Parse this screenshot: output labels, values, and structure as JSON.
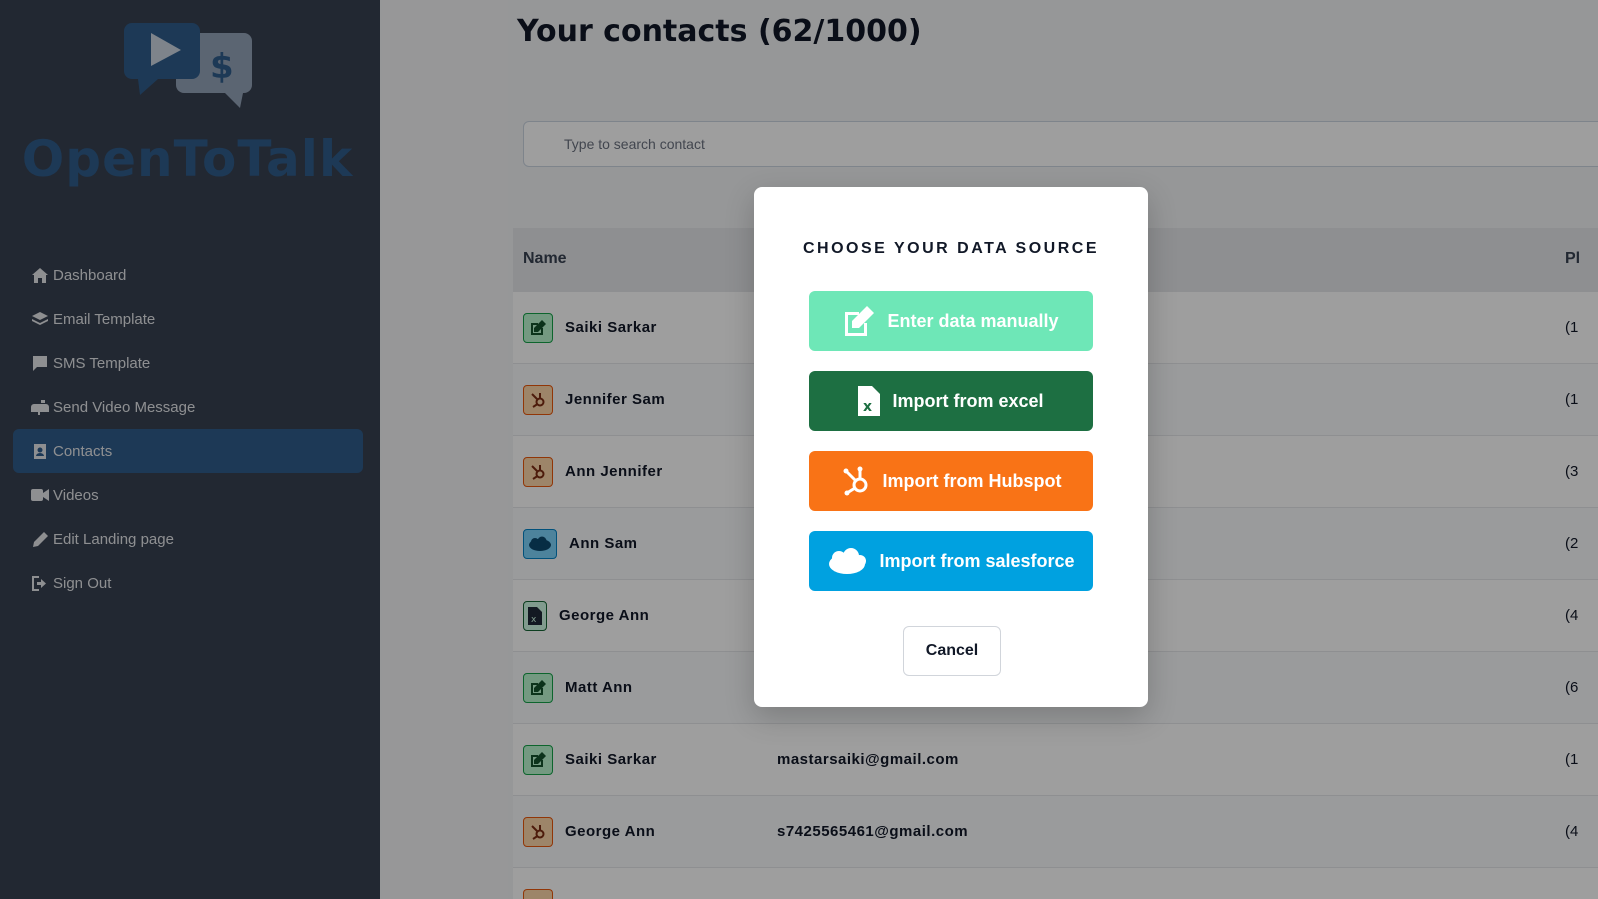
{
  "brand": {
    "name": "OpenToTalk"
  },
  "sidebar": {
    "items": [
      {
        "label": "Dashboard",
        "icon": "home-icon"
      },
      {
        "label": "Email Template",
        "icon": "layers-icon"
      },
      {
        "label": "SMS Template",
        "icon": "comment-icon"
      },
      {
        "label": "Send Video Message",
        "icon": "mailbox-icon"
      },
      {
        "label": "Contacts",
        "icon": "address-book-icon",
        "active": true
      },
      {
        "label": "Videos",
        "icon": "video-icon"
      },
      {
        "label": "Edit Landing page",
        "icon": "pen-icon"
      },
      {
        "label": "Sign Out",
        "icon": "sign-out-icon"
      }
    ]
  },
  "main": {
    "title": "Your contacts (62/1000)",
    "search": {
      "placeholder": "Type to search contact",
      "value": ""
    },
    "table": {
      "columns": [
        "Name",
        "Pl"
      ],
      "rows": [
        {
          "source": "manual",
          "name": "Saiki Sarkar",
          "email": "",
          "phone": "(1"
        },
        {
          "source": "hubspot",
          "name": "Jennifer Sam",
          "email": "",
          "phone": "(1"
        },
        {
          "source": "hubspot",
          "name": "Ann Jennifer",
          "email": "",
          "phone": "(3"
        },
        {
          "source": "salesforce",
          "name": "Ann Sam",
          "email": "",
          "phone": "(2"
        },
        {
          "source": "excel",
          "name": "George Ann",
          "email": "",
          "phone": "(4"
        },
        {
          "source": "manual",
          "name": "Matt Ann",
          "email": "",
          "phone": "(6"
        },
        {
          "source": "manual",
          "name": "Saiki Sarkar",
          "email": "mastarsaiki@gmail.com",
          "phone": "(1"
        },
        {
          "source": "hubspot",
          "name": "George Ann",
          "email": "s7425565461@gmail.com",
          "phone": "(4"
        }
      ]
    }
  },
  "modal": {
    "title": "CHOOSE YOUR DATA SOURCE",
    "buttons": {
      "manual": "Enter data manually",
      "excel": "Import from excel",
      "hubspot": "Import from Hubspot",
      "salesforce": "Import from salesforce"
    },
    "cancel": "Cancel"
  },
  "colors": {
    "sidebar_bg": "#374151",
    "accent": "#2f5d8c",
    "manual": "#6ee7b7",
    "excel": "#1d6f42",
    "hubspot": "#f97316",
    "salesforce": "#00a1e0"
  }
}
